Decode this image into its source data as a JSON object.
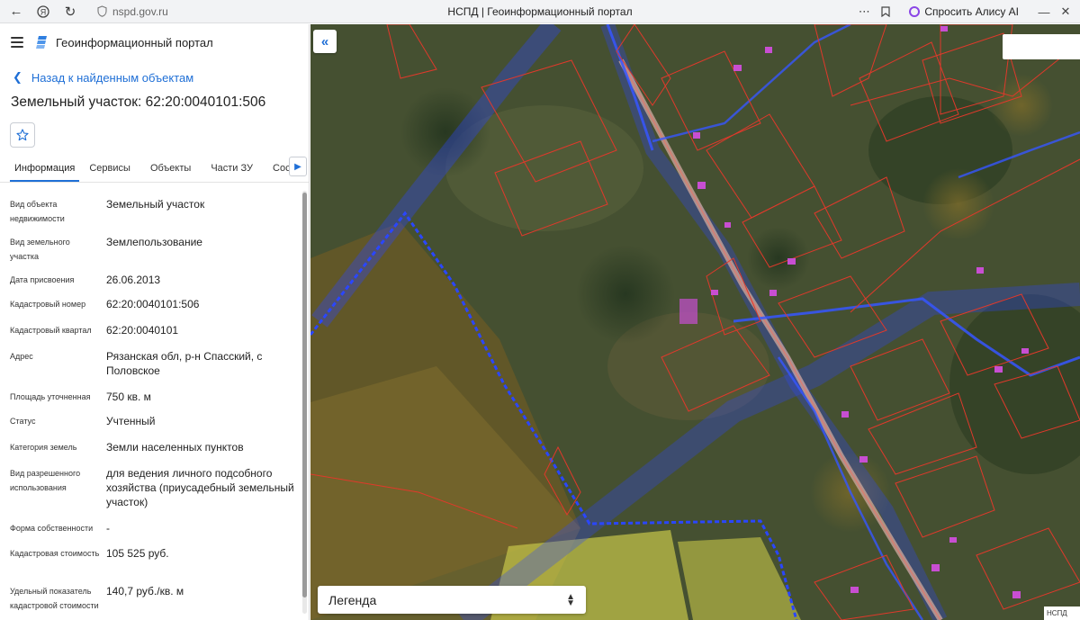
{
  "browser": {
    "url": "nspd.gov.ru",
    "tab_title": "НСПД | Геоинформационный портал",
    "alice_label": "Спросить Алису AI"
  },
  "app": {
    "title": "Геоинформационный портал"
  },
  "panel": {
    "back_label": "Назад к найденным объектам",
    "object_title": "Земельный участок: 62:20:0040101:506",
    "tabs": [
      {
        "label": "Информация",
        "active": true
      },
      {
        "label": "Сервисы"
      },
      {
        "label": "Объекты"
      },
      {
        "label": "Части ЗУ"
      },
      {
        "label": "Состав"
      }
    ],
    "attributes": [
      {
        "key": "Вид объекта недвижимости",
        "value": "Земельный участок"
      },
      {
        "key": "Вид земельного участка",
        "value": "Землепользование"
      },
      {
        "key": "Дата присвоения",
        "value": "26.06.2013"
      },
      {
        "key": "Кадастровый номер",
        "value": "62:20:0040101:506"
      },
      {
        "key": "Кадастровый квартал",
        "value": "62:20:0040101"
      },
      {
        "key": "Адрес",
        "value": "Рязанская обл, р-н Спасский, с Половское"
      },
      {
        "key": "Площадь уточненная",
        "value": "750 кв. м"
      },
      {
        "key": "Статус",
        "value": "Учтенный"
      },
      {
        "key": "Категория земель",
        "value": "Земли населенных пунктов"
      },
      {
        "key": "Вид разрешенного использования",
        "value": "для ведения личного подсобного хозяйства (приусадебный земельный участок)"
      },
      {
        "key": "Форма собственности",
        "value": "-"
      },
      {
        "key": "Кадастровая стоимость",
        "value": "105 525 руб."
      },
      {
        "key": "Удельный показатель кадастровой стоимости",
        "value": "140,7 руб./кв. м"
      }
    ]
  },
  "map": {
    "legend_label": "Легенда",
    "attribution": "НСПД"
  },
  "colors": {
    "accent": "#1f6fd6",
    "parcel_outline": "#e0392b",
    "boundary": "#2a46ff",
    "highlight_zone": "#c8c64a"
  }
}
